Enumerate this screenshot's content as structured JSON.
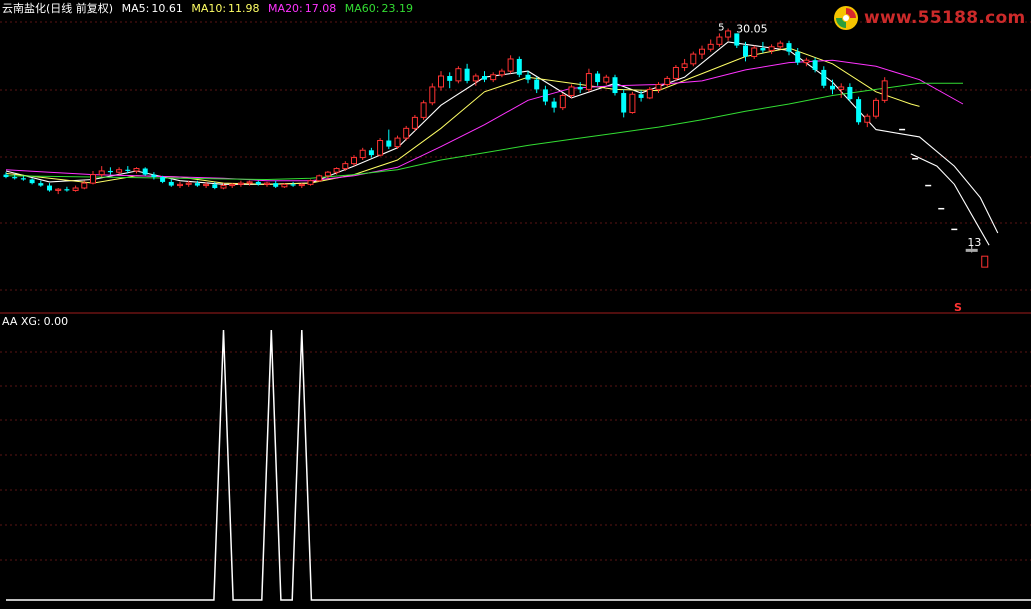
{
  "header": {
    "title": "云南盐化(日线 前复权)",
    "ma": [
      {
        "label": "MA5:",
        "value": "10.61",
        "color": "#ffffff"
      },
      {
        "label": "MA10:",
        "value": "11.98",
        "color": "#ffff66"
      },
      {
        "label": "MA20:",
        "value": "17.08",
        "color": "#ff33ff"
      },
      {
        "label": "MA60:",
        "value": "23.19",
        "color": "#33dd33"
      }
    ],
    "title_color": "#ffffff"
  },
  "indicator_header": {
    "label": "AA XG:",
    "value": "0.00",
    "color": "#ffffff"
  },
  "watermark": {
    "text": "www.55188.com",
    "color": "#cc2a2a"
  },
  "chart_data": [
    {
      "type": "candlestick",
      "title": "云南盐化(日线 前复权)",
      "ylim": [
        10,
        33
      ],
      "up_color": "#ff3333",
      "down_color": "#00ffff",
      "candles": [
        [
          20.3,
          20.5,
          20.0,
          20.1
        ],
        [
          20.1,
          20.3,
          19.9,
          20.0
        ],
        [
          20.0,
          20.2,
          19.8,
          19.9
        ],
        [
          19.9,
          20.0,
          19.5,
          19.6
        ],
        [
          19.6,
          19.8,
          19.3,
          19.4
        ],
        [
          19.4,
          19.6,
          18.9,
          19.0
        ],
        [
          19.0,
          19.2,
          18.7,
          19.1
        ],
        [
          19.1,
          19.3,
          18.9,
          19.0
        ],
        [
          19.0,
          19.4,
          18.9,
          19.2
        ],
        [
          19.2,
          19.8,
          19.1,
          19.6
        ],
        [
          19.6,
          20.6,
          19.5,
          20.3
        ],
        [
          20.3,
          21.0,
          20.1,
          20.6
        ],
        [
          20.6,
          20.9,
          20.3,
          20.5
        ],
        [
          20.5,
          20.9,
          20.3,
          20.7
        ],
        [
          20.7,
          21.0,
          20.4,
          20.6
        ],
        [
          20.6,
          20.9,
          20.4,
          20.8
        ],
        [
          20.8,
          20.9,
          20.2,
          20.3
        ],
        [
          20.3,
          20.5,
          19.9,
          20.1
        ],
        [
          20.1,
          20.2,
          19.6,
          19.7
        ],
        [
          19.7,
          19.9,
          19.3,
          19.4
        ],
        [
          19.4,
          19.7,
          19.2,
          19.5
        ],
        [
          19.5,
          19.8,
          19.3,
          19.6
        ],
        [
          19.6,
          19.8,
          19.3,
          19.4
        ],
        [
          19.4,
          19.7,
          19.2,
          19.5
        ],
        [
          19.5,
          19.7,
          19.1,
          19.2
        ],
        [
          19.2,
          19.6,
          19.1,
          19.4
        ],
        [
          19.4,
          19.6,
          19.2,
          19.5
        ],
        [
          19.5,
          19.8,
          19.3,
          19.6
        ],
        [
          19.6,
          19.8,
          19.4,
          19.7
        ],
        [
          19.7,
          19.8,
          19.4,
          19.5
        ],
        [
          19.5,
          19.7,
          19.3,
          19.6
        ],
        [
          19.6,
          19.8,
          19.2,
          19.3
        ],
        [
          19.3,
          19.6,
          19.2,
          19.5
        ],
        [
          19.5,
          19.7,
          19.3,
          19.4
        ],
        [
          19.4,
          19.6,
          19.2,
          19.5
        ],
        [
          19.5,
          19.9,
          19.4,
          19.8
        ],
        [
          19.8,
          20.3,
          19.7,
          20.2
        ],
        [
          20.2,
          20.6,
          20.0,
          20.5
        ],
        [
          20.5,
          20.9,
          20.3,
          20.8
        ],
        [
          20.8,
          21.4,
          20.6,
          21.2
        ],
        [
          21.2,
          21.9,
          21.0,
          21.7
        ],
        [
          21.7,
          22.5,
          21.5,
          22.3
        ],
        [
          22.3,
          22.5,
          21.7,
          21.9
        ],
        [
          21.9,
          23.3,
          21.8,
          23.1
        ],
        [
          23.1,
          24.0,
          22.4,
          22.6
        ],
        [
          22.6,
          23.5,
          22.4,
          23.3
        ],
        [
          23.3,
          24.3,
          23.1,
          24.1
        ],
        [
          24.1,
          25.2,
          23.9,
          25.0
        ],
        [
          25.0,
          26.4,
          24.8,
          26.2
        ],
        [
          26.2,
          27.8,
          26.0,
          27.5
        ],
        [
          27.5,
          28.8,
          27.2,
          28.4
        ],
        [
          28.4,
          28.7,
          27.4,
          28.0
        ],
        [
          28.0,
          29.2,
          27.8,
          29.0
        ],
        [
          29.0,
          29.4,
          27.8,
          28.0
        ],
        [
          28.0,
          28.6,
          27.6,
          28.4
        ],
        [
          28.4,
          28.8,
          27.9,
          28.1
        ],
        [
          28.1,
          28.7,
          27.9,
          28.5
        ],
        [
          28.5,
          29.0,
          28.3,
          28.8
        ],
        [
          28.8,
          30.1,
          28.6,
          29.8
        ],
        [
          29.8,
          30.0,
          28.3,
          28.5
        ],
        [
          28.5,
          28.8,
          27.8,
          28.1
        ],
        [
          28.1,
          28.3,
          27.0,
          27.3
        ],
        [
          27.3,
          27.6,
          26.0,
          26.3
        ],
        [
          26.3,
          26.6,
          25.4,
          25.8
        ],
        [
          25.8,
          27.0,
          25.6,
          26.8
        ],
        [
          26.8,
          27.7,
          26.6,
          27.5
        ],
        [
          27.5,
          27.9,
          27.0,
          27.3
        ],
        [
          27.3,
          29.0,
          27.1,
          28.6
        ],
        [
          28.6,
          28.8,
          27.6,
          27.9
        ],
        [
          27.9,
          28.5,
          27.7,
          28.3
        ],
        [
          28.3,
          28.5,
          26.8,
          27.0
        ],
        [
          27.0,
          27.3,
          25.0,
          25.4
        ],
        [
          25.4,
          27.1,
          25.3,
          26.9
        ],
        [
          26.9,
          27.2,
          26.3,
          26.6
        ],
        [
          26.6,
          27.5,
          26.5,
          27.3
        ],
        [
          27.3,
          27.9,
          27.0,
          27.7
        ],
        [
          27.7,
          28.4,
          27.5,
          28.2
        ],
        [
          28.2,
          29.3,
          28.0,
          29.1
        ],
        [
          29.1,
          29.8,
          28.8,
          29.4
        ],
        [
          29.4,
          30.4,
          29.2,
          30.2
        ],
        [
          30.2,
          30.9,
          29.8,
          30.6
        ],
        [
          30.6,
          31.4,
          30.4,
          31.0
        ],
        [
          31.0,
          31.9,
          30.8,
          31.6
        ],
        [
          31.6,
          32.3,
          31.3,
          32.1
        ],
        [
          31.9,
          31.9,
          30.7,
          30.9
        ],
        [
          30.9,
          31.2,
          29.6,
          30.0
        ],
        [
          30.0,
          30.9,
          29.8,
          30.7
        ],
        [
          30.7,
          31.2,
          30.3,
          30.5
        ],
        [
          30.5,
          31.0,
          30.2,
          30.8
        ],
        [
          30.8,
          31.3,
          30.6,
          31.1
        ],
        [
          31.1,
          31.3,
          30.1,
          30.4
        ],
        [
          30.4,
          30.7,
          29.3,
          29.5
        ],
        [
          29.5,
          29.9,
          29.2,
          29.7
        ],
        [
          29.7,
          29.9,
          28.7,
          28.9
        ],
        [
          28.9,
          29.2,
          27.4,
          27.6
        ],
        [
          27.6,
          28.1,
          26.9,
          27.3
        ],
        [
          27.3,
          27.8,
          26.6,
          27.5
        ],
        [
          27.5,
          27.8,
          26.3,
          26.5
        ],
        [
          26.5,
          26.7,
          24.4,
          24.6
        ],
        [
          24.6,
          25.3,
          24.2,
          25.1
        ],
        [
          25.1,
          26.6,
          24.9,
          26.4
        ],
        [
          26.4,
          28.3,
          26.2,
          28.0
        ]
      ],
      "limit_down": [
        24.0,
        21.6,
        19.4,
        17.5,
        15.8
      ],
      "last_candle": [
        14.2,
        14.5,
        13.9,
        14.1
      ],
      "last_down": [
        13.3,
        13.6,
        12.7,
        12.8
      ],
      "ma_series": [
        {
          "name": "MA5",
          "color": "#ffffff",
          "width": 1.1,
          "points": [
            [
              0,
              20.6
            ],
            [
              5,
              19.7
            ],
            [
              10,
              19.9
            ],
            [
              15,
              20.6
            ],
            [
              20,
              19.8
            ],
            [
              25,
              19.5
            ],
            [
              30,
              19.5
            ],
            [
              35,
              19.6
            ],
            [
              40,
              21.0
            ],
            [
              45,
              22.5
            ],
            [
              50,
              26.0
            ],
            [
              55,
              28.3
            ],
            [
              60,
              28.8
            ],
            [
              65,
              26.6
            ],
            [
              70,
              27.8
            ],
            [
              73,
              27.0
            ],
            [
              78,
              28.3
            ],
            [
              83,
              31.2
            ],
            [
              86,
              30.9
            ],
            [
              90,
              30.5
            ],
            [
              95,
              27.9
            ],
            [
              100,
              24.0
            ],
            [
              105,
              23.4
            ],
            [
              109,
              21.0
            ],
            [
              112,
              18.4
            ],
            [
              114,
              15.5
            ]
          ]
        },
        {
          "name": "MA10",
          "color": "#ffff66",
          "width": 1.0,
          "points": [
            [
              0,
              20.4
            ],
            [
              5,
              20.0
            ],
            [
              10,
              19.6
            ],
            [
              15,
              20.2
            ],
            [
              20,
              20.1
            ],
            [
              25,
              19.6
            ],
            [
              30,
              19.5
            ],
            [
              35,
              19.6
            ],
            [
              40,
              20.3
            ],
            [
              45,
              21.5
            ],
            [
              50,
              24.1
            ],
            [
              55,
              27.1
            ],
            [
              60,
              28.3
            ],
            [
              65,
              27.8
            ],
            [
              70,
              27.3
            ],
            [
              75,
              27.2
            ],
            [
              80,
              28.6
            ],
            [
              85,
              30.0
            ],
            [
              90,
              30.7
            ],
            [
              95,
              29.4
            ],
            [
              100,
              27.1
            ],
            [
              104,
              26.1
            ],
            [
              105,
              25.9
            ]
          ]
        },
        {
          "name": "MA20",
          "color": "#ff33ff",
          "width": 1.0,
          "points": [
            [
              0,
              20.7
            ],
            [
              5,
              20.5
            ],
            [
              10,
              20.3
            ],
            [
              15,
              20.2
            ],
            [
              20,
              20.1
            ],
            [
              25,
              20.0
            ],
            [
              30,
              19.8
            ],
            [
              35,
              19.8
            ],
            [
              40,
              20.2
            ],
            [
              45,
              20.9
            ],
            [
              50,
              22.6
            ],
            [
              55,
              24.4
            ],
            [
              60,
              26.4
            ],
            [
              65,
              27.4
            ],
            [
              70,
              27.6
            ],
            [
              75,
              27.7
            ],
            [
              80,
              28.0
            ],
            [
              85,
              28.9
            ],
            [
              90,
              29.5
            ],
            [
              95,
              29.7
            ],
            [
              100,
              29.2
            ],
            [
              105,
              28.1
            ],
            [
              110,
              26.1
            ]
          ]
        },
        {
          "name": "MA60",
          "color": "#33dd33",
          "width": 1.0,
          "points": [
            [
              0,
              20.2
            ],
            [
              10,
              20.1
            ],
            [
              20,
              20.0
            ],
            [
              30,
              19.9
            ],
            [
              35,
              20.0
            ],
            [
              40,
              20.3
            ],
            [
              45,
              20.7
            ],
            [
              50,
              21.5
            ],
            [
              55,
              22.1
            ],
            [
              60,
              22.7
            ],
            [
              65,
              23.2
            ],
            [
              70,
              23.7
            ],
            [
              75,
              24.2
            ],
            [
              80,
              24.8
            ],
            [
              85,
              25.5
            ],
            [
              90,
              26.1
            ],
            [
              95,
              26.8
            ],
            [
              100,
              27.3
            ],
            [
              105,
              27.8
            ],
            [
              110,
              27.8
            ]
          ]
        }
      ],
      "annotations": [
        {
          "text": "30.05",
          "color": "#ffffff"
        },
        {
          "text": "13",
          "color": "#ffffff"
        },
        {
          "text": "5",
          "color": "#ffffff"
        }
      ],
      "signal_marker": {
        "text": "S",
        "color": "#ff3333"
      }
    },
    {
      "type": "line",
      "title": "AA XG",
      "ylim": [
        0,
        1
      ],
      "color": "#ffffff",
      "values_x": [
        0,
        24,
        26,
        28,
        30,
        32,
        34,
        36,
        118
      ],
      "values_y": [
        0,
        0,
        1,
        0,
        0,
        1,
        0,
        1,
        0
      ],
      "spikes_at": [
        25,
        30.5,
        34
      ]
    }
  ]
}
